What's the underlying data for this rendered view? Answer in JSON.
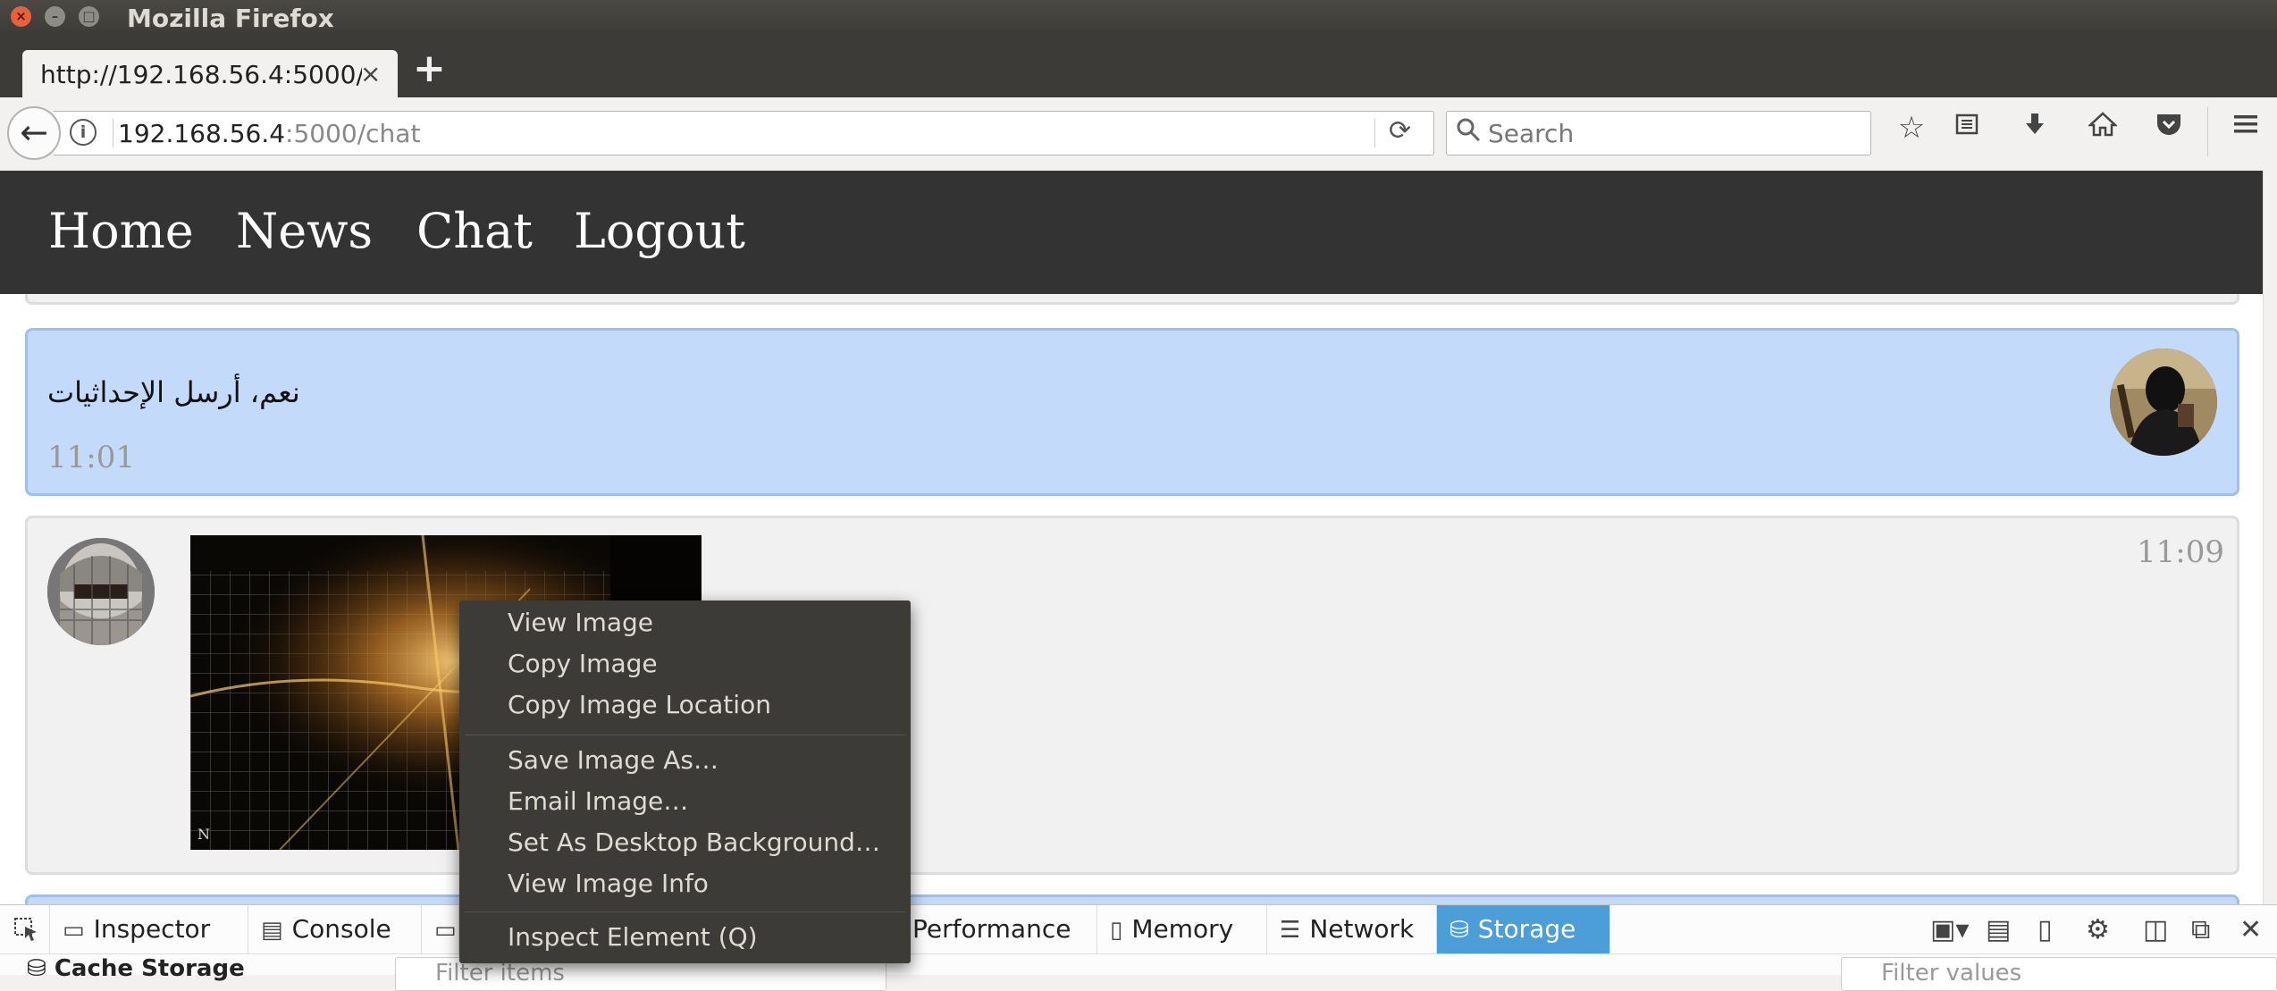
{
  "window": {
    "title": "Mozilla Firefox"
  },
  "tab": {
    "title": "http://192.168.56.4:5000/chat",
    "close_glyph": "×",
    "new_tab_glyph": "+"
  },
  "navbar": {
    "url_host": "192.168.56.4",
    "url_rest": ":5000/chat",
    "search_placeholder": "Search"
  },
  "site_nav": {
    "items": [
      "Home",
      "News",
      "Chat",
      "Logout"
    ]
  },
  "messages": [
    {
      "text": "نعم، أرسل الإحداثيات",
      "time": "11:01"
    },
    {
      "time": "11:09"
    }
  ],
  "context_menu": {
    "items": [
      "View Image",
      "Copy Image",
      "Copy Image Location",
      "Save Image As…",
      "Email Image…",
      "Set As Desktop Background…",
      "View Image Info",
      "Inspect Element (Q)"
    ]
  },
  "devtools": {
    "tabs": [
      "Inspector",
      "Console",
      "Performance",
      "Memory",
      "Network",
      "Storage"
    ],
    "active_tab": "Storage",
    "sidebar_label": "Cache Storage",
    "filter_items_placeholder": "Filter items",
    "filter_values_placeholder": "Filter values"
  },
  "icons": {
    "back": "back-arrow-icon",
    "info": "info-icon",
    "reload": "reload-icon",
    "search": "search-icon",
    "bookmark": "star-icon",
    "reading_list": "reading-list-icon",
    "downloads": "download-icon",
    "home": "home-icon",
    "pocket": "pocket-icon",
    "menu": "hamburger-menu-icon"
  },
  "colors": {
    "titlebar": "#3c3b37",
    "site_nav": "#333333",
    "incoming_bubble": "#c4dafa",
    "outgoing_bubble": "#f1f1f1",
    "devtools_active": "#4c9ed9"
  }
}
